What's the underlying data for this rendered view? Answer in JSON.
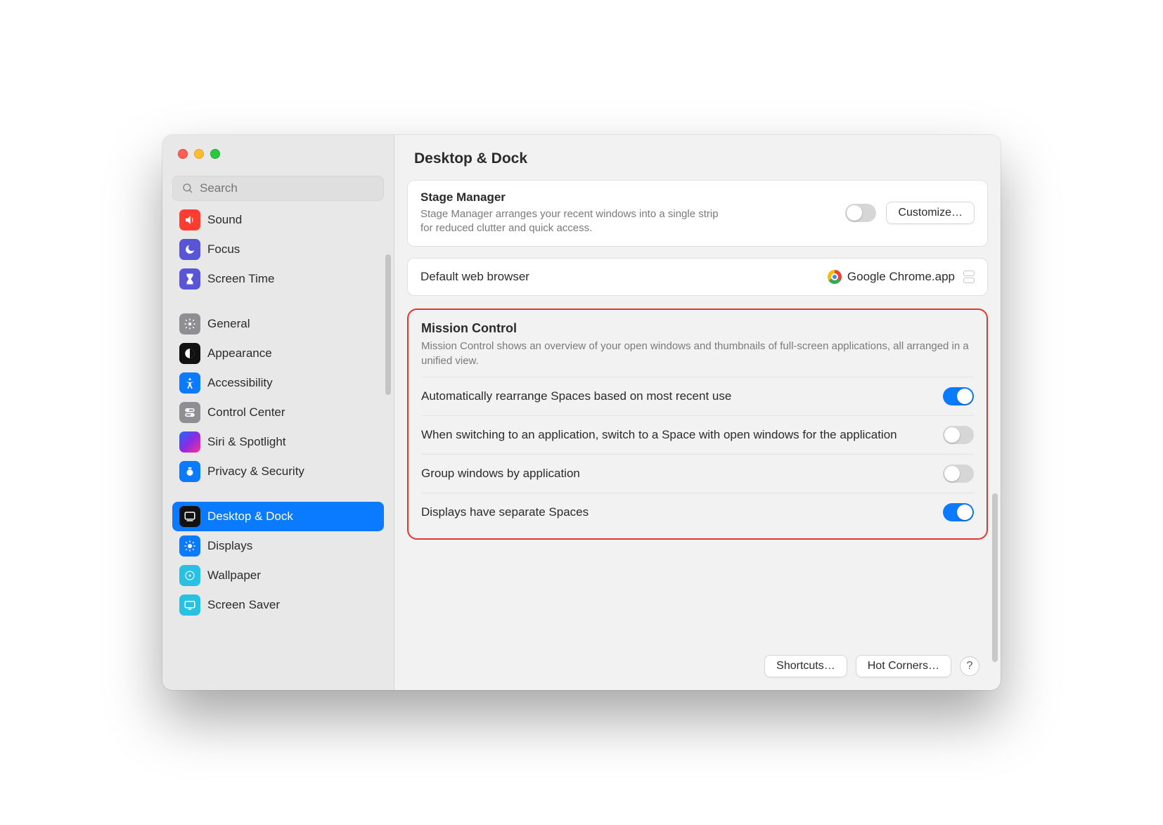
{
  "search": {
    "placeholder": "Search"
  },
  "title": "Desktop & Dock",
  "sidebar": {
    "items": [
      {
        "label": "Sound"
      },
      {
        "label": "Focus"
      },
      {
        "label": "Screen Time"
      },
      {
        "label": "General"
      },
      {
        "label": "Appearance"
      },
      {
        "label": "Accessibility"
      },
      {
        "label": "Control Center"
      },
      {
        "label": "Siri & Spotlight"
      },
      {
        "label": "Privacy & Security"
      },
      {
        "label": "Desktop & Dock"
      },
      {
        "label": "Displays"
      },
      {
        "label": "Wallpaper"
      },
      {
        "label": "Screen Saver"
      }
    ]
  },
  "stage": {
    "title": "Stage Manager",
    "sub": "Stage Manager arranges your recent windows into a single strip for reduced clutter and quick access.",
    "customize": "Customize…"
  },
  "browser": {
    "label": "Default web browser",
    "value": "Google Chrome.app"
  },
  "mission": {
    "title": "Mission Control",
    "sub": "Mission Control shows an overview of your open windows and thumbnails of full-screen applications, all arranged in a unified view.",
    "rows": [
      {
        "label": "Automatically rearrange Spaces based on most recent use",
        "on": true
      },
      {
        "label": "When switching to an application, switch to a Space with open windows for the application",
        "on": false
      },
      {
        "label": "Group windows by application",
        "on": false
      },
      {
        "label": "Displays have separate Spaces",
        "on": true
      }
    ]
  },
  "footer": {
    "shortcuts": "Shortcuts…",
    "hotcorners": "Hot Corners…",
    "help": "?"
  }
}
